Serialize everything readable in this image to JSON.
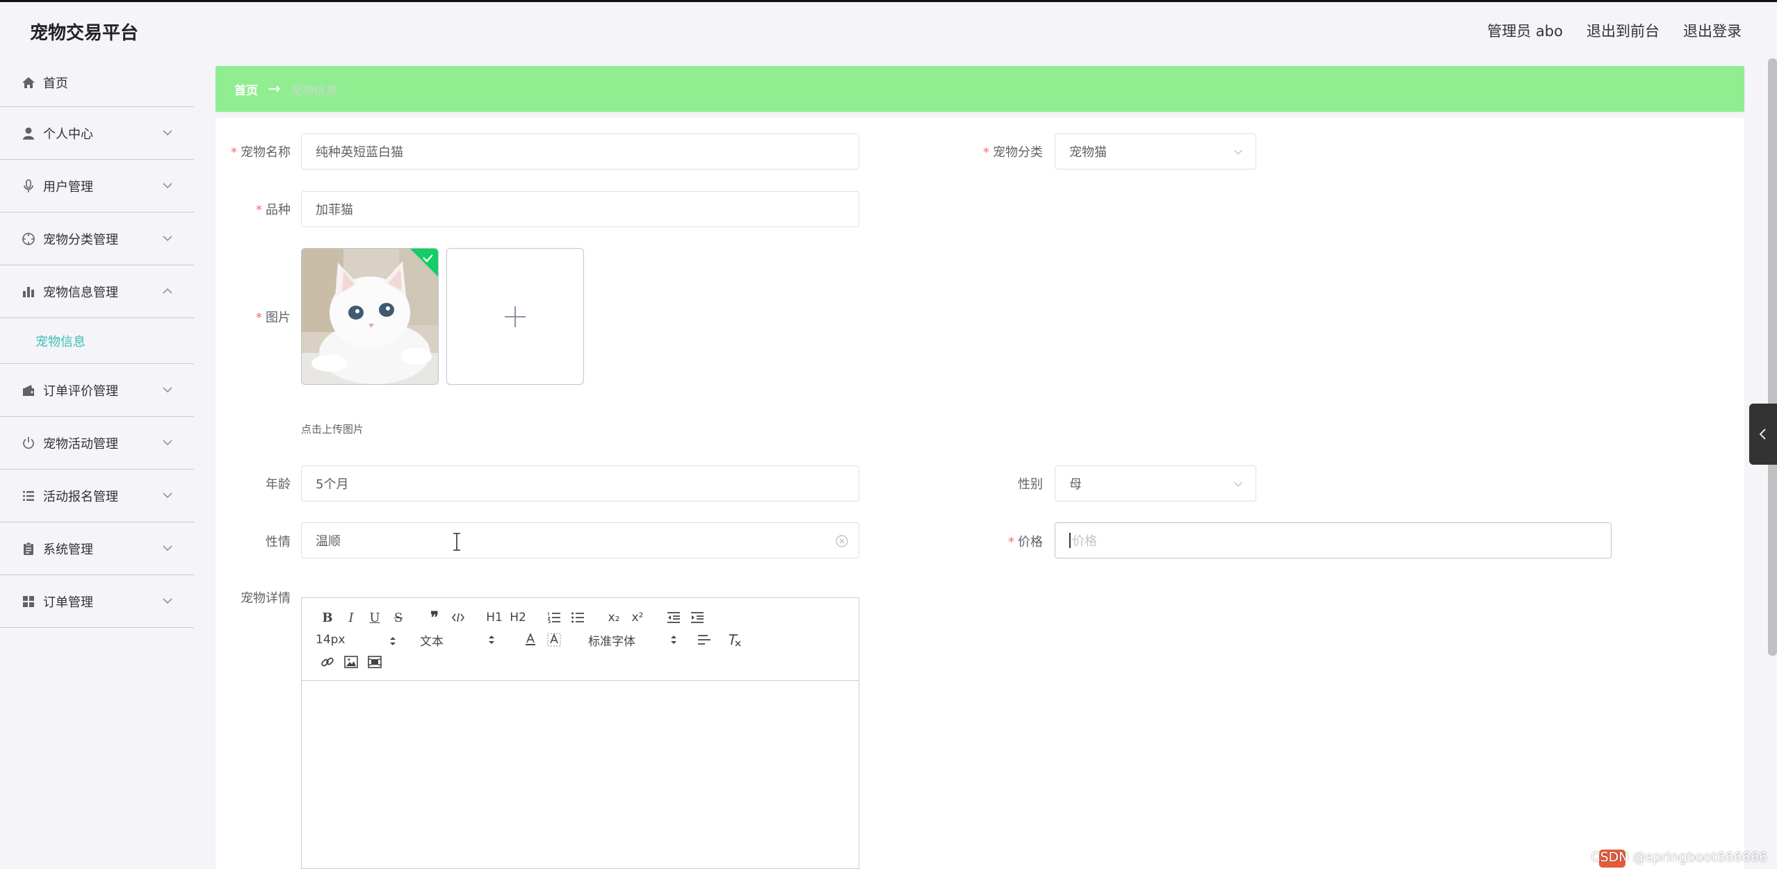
{
  "header": {
    "brand": "宠物交易平台",
    "admin": "管理员 abo",
    "to_front": "退出到前台",
    "logout": "退出登录"
  },
  "sidebar": {
    "items": [
      {
        "label": "首页",
        "icon": "home-icon"
      },
      {
        "label": "个人中心",
        "icon": "user-icon"
      },
      {
        "label": "用户管理",
        "icon": "microphone-icon"
      },
      {
        "label": "宠物分类管理",
        "icon": "compass-icon"
      },
      {
        "label": "宠物信息管理",
        "icon": "bar-chart-icon"
      },
      {
        "label": "订单评价管理",
        "icon": "wallet-icon"
      },
      {
        "label": "宠物活动管理",
        "icon": "power-icon"
      },
      {
        "label": "活动报名管理",
        "icon": "list-icon"
      },
      {
        "label": "系统管理",
        "icon": "clipboard-icon"
      },
      {
        "label": "订单管理",
        "icon": "grid-icon"
      }
    ],
    "subitem": "宠物信息"
  },
  "breadcrumb": {
    "home": "首页",
    "sep": "→",
    "current": "宠物信息"
  },
  "form": {
    "name_label": "宠物名称",
    "name_value": "纯种英短蓝白猫",
    "category_label": "宠物分类",
    "category_value": "宠物猫",
    "breed_label": "品种",
    "breed_value": "加菲猫",
    "image_label": "图片",
    "upload_tip": "点击上传图片",
    "age_label": "年龄",
    "age_value": "5个月",
    "gender_label": "性别",
    "gender_value": "母",
    "temper_label": "性情",
    "temper_value": "温顺",
    "price_label": "价格",
    "price_placeholder": "价格",
    "detail_label": "宠物详情",
    "required_mark": "*"
  },
  "editor": {
    "font_size": "14px",
    "header_select": "文本",
    "font_family": "标准字体",
    "h1": "H1",
    "h2": "H2"
  },
  "watermark": "CSDN @springboot666666",
  "colors": {
    "breadcrumb_bg": "#90ee90",
    "active_submenu": "#3cbfb3",
    "required": "#f56c6c",
    "success_badge": "#13ce66"
  }
}
